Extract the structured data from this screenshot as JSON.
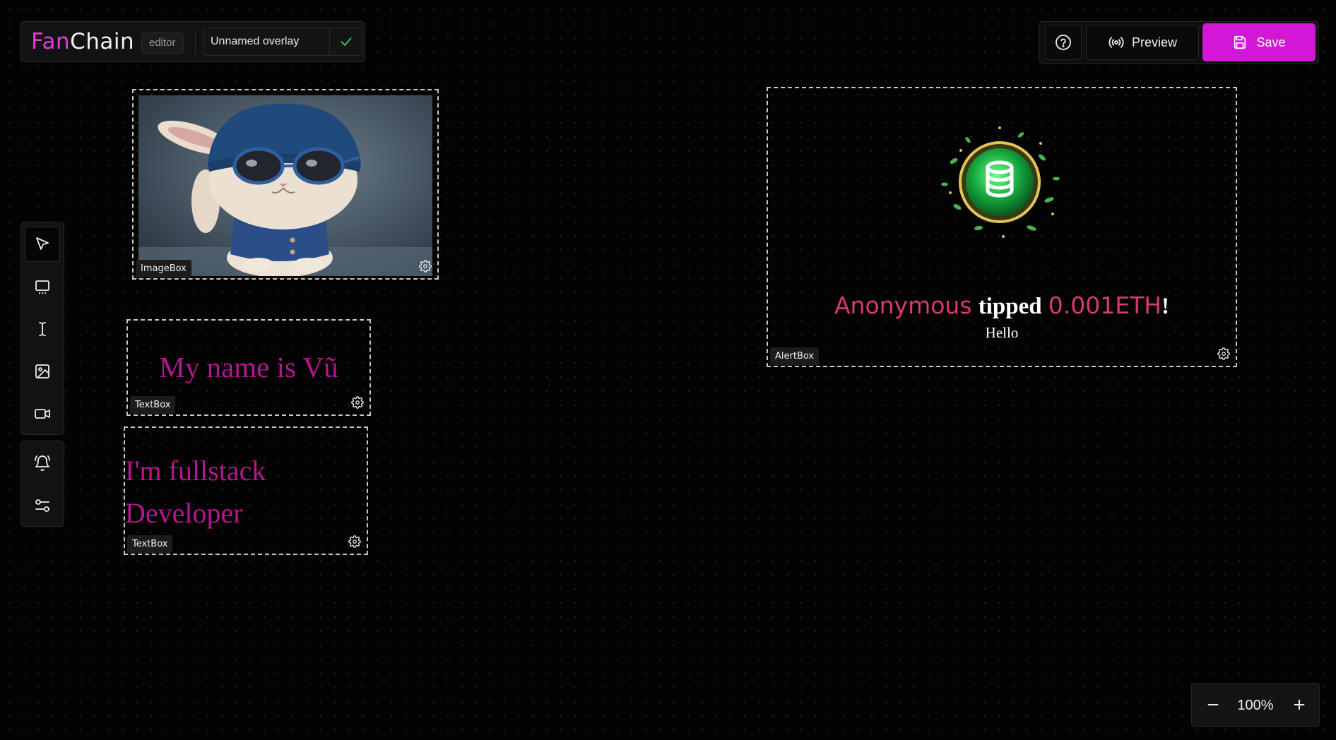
{
  "header": {
    "logo_part1": "Fan",
    "logo_part2": "Chain",
    "mode_badge": "editor",
    "overlay_name": "Unnamed overlay"
  },
  "actions": {
    "preview_label": "Preview",
    "save_label": "Save"
  },
  "toolbar": {
    "tools": [
      "select",
      "rectangle",
      "text",
      "image",
      "video"
    ],
    "extra": [
      "alert",
      "settings"
    ],
    "active": "select"
  },
  "canvas": {
    "image_box": {
      "tag": "ImageBox"
    },
    "text_box_1": {
      "tag": "TextBox",
      "text": "My name is Vũ"
    },
    "text_box_2": {
      "tag": "TextBox",
      "line1": "I'm fullstack",
      "line2": "Developer"
    },
    "alert_box": {
      "tag": "AlertBox",
      "sender": "Anonymous",
      "verb": "tipped",
      "amount": "0.001ETH",
      "punct": "!",
      "message": "Hello"
    }
  },
  "zoom": {
    "value": "100%"
  },
  "colors": {
    "brand_pink": "#e23bd9",
    "save_button": "#d218d6",
    "text_magenta": "#b5168f",
    "alert_pink": "#d63a6e",
    "confirm_green": "#3ddc6a"
  }
}
